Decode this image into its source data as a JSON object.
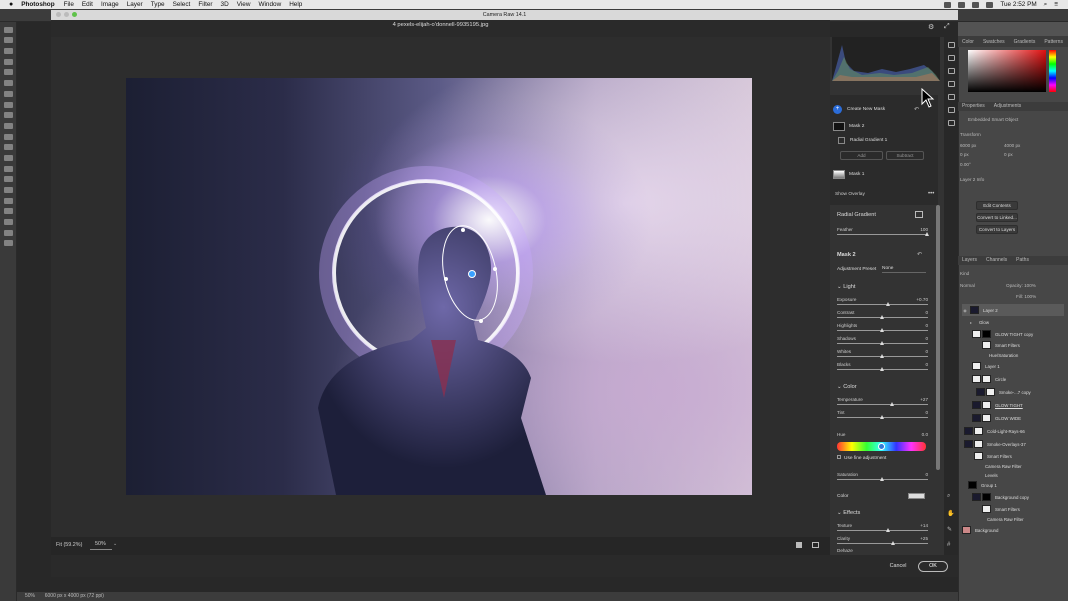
{
  "menubar": {
    "app": "Photoshop",
    "items": [
      "File",
      "Edit",
      "Image",
      "Layer",
      "Type",
      "Select",
      "Filter",
      "3D",
      "View",
      "Window",
      "Help"
    ],
    "clock": "Tue 2:52 PM"
  },
  "dialog": {
    "title": "Camera Raw 14.1",
    "filename": "4 pexels-elijah-o'donnell-9935195.jpg",
    "fit_label": "Fit (59.2%)",
    "zoom": "50%",
    "cancel": "Cancel",
    "ok": "OK"
  },
  "masks": {
    "create_new": "Create New Mask",
    "mask2": "Mask 2",
    "radial1": "Radial Gradient 1",
    "add": "Add",
    "subtract": "Subtract",
    "mask1": "Mask 1",
    "show_overlay": "Show Overlay"
  },
  "radial": {
    "title": "Radial Gradient",
    "feather_label": "Feather",
    "feather": 100
  },
  "mask_panel": {
    "title": "Mask 2",
    "preset_label": "Adjustment Preset",
    "preset": "None"
  },
  "light": {
    "title": "Light",
    "sliders": [
      {
        "label": "Exposure",
        "value": "+0.70",
        "frac": 0.57
      },
      {
        "label": "Contrast",
        "value": "0",
        "frac": 0.5
      },
      {
        "label": "Highlights",
        "value": "0",
        "frac": 0.5
      },
      {
        "label": "Shadows",
        "value": "0",
        "frac": 0.5
      },
      {
        "label": "Whites",
        "value": "0",
        "frac": 0.5
      },
      {
        "label": "Blacks",
        "value": "0",
        "frac": 0.5
      }
    ]
  },
  "color": {
    "title": "Color",
    "sliders": [
      {
        "label": "Temperature",
        "value": "+27",
        "frac": 0.61
      },
      {
        "label": "Tint",
        "value": "0",
        "frac": 0.5
      }
    ],
    "hue_label": "Hue",
    "hue_value": "0.0",
    "fine_adjust": "Use fine adjustment",
    "saturation_label": "Saturation",
    "saturation_value": "0",
    "color_label": "Color"
  },
  "effects": {
    "title": "Effects",
    "sliders": [
      {
        "label": "Texture",
        "value": "+14",
        "frac": 0.57
      },
      {
        "label": "Clarity",
        "value": "+25",
        "frac": 0.62
      }
    ],
    "dehaze": "Dehaze"
  },
  "ps_panels": {
    "tabs1": [
      "Color",
      "Swatches",
      "Gradients",
      "Patterns"
    ],
    "prop_tabs": [
      "Properties",
      "Adjustments"
    ],
    "embedded": "Embedded Smart Object",
    "transform": "Transform",
    "w": "6000 px",
    "h": "4000 px",
    "x": "0 px",
    "y": "0 px",
    "angle": "0.00°",
    "layer_comp": "Layer 2 Info",
    "edit_contents": "Edit Contents",
    "convert_linked": "Convert to Linked...",
    "convert_layers": "Convert to Layers",
    "layer_tabs": [
      "Layers",
      "Channels",
      "Paths"
    ],
    "kind": "Kind",
    "blend": "Normal",
    "opacity": "Opacity: 100%",
    "fill": "Fill: 100%",
    "layers": [
      "Layer 2",
      "Glow",
      "GLOW TIGHT copy",
      "Smart Filters",
      "Hue/Saturation",
      "Layer 1",
      "Circle",
      "Smoke-...7 copy",
      "GLOW TIGHT",
      "GLOW WIDE",
      "Cold-Light-Rays-66",
      "Smoke-Overlays-37",
      "Smart Filters",
      "Camera Raw Filter",
      "Levels",
      "Group 1",
      "Background copy",
      "Smart Filters",
      "Camera Raw Filter",
      "Background"
    ]
  },
  "status": "50%       6000 px x 4000 px (72 ppi)"
}
